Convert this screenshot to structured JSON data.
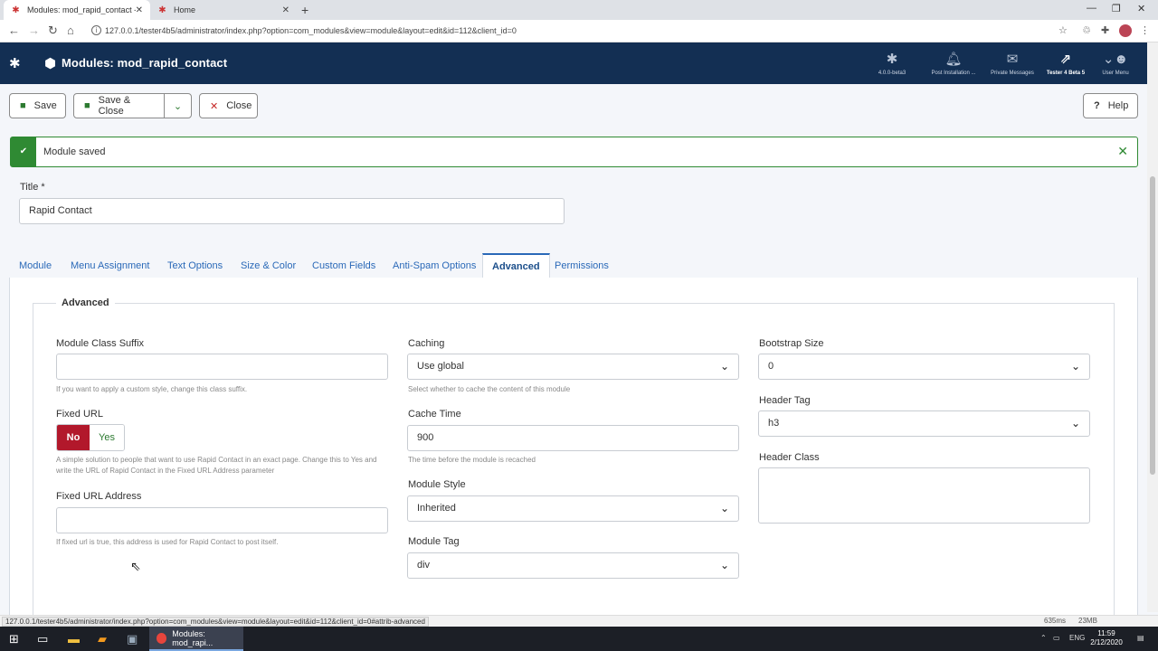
{
  "browser": {
    "tabs": [
      {
        "title": "Modules: mod_rapid_contact - Te",
        "close": "✕"
      },
      {
        "title": "Home",
        "close": "✕"
      }
    ],
    "new_tab": "+",
    "url": "127.0.0.1/tester4b5/administrator/index.php?option=com_modules&view=module&layout=edit&id=112&client_id=0",
    "window_controls": {
      "minimize": "—",
      "restore": "❐",
      "close": "✕"
    }
  },
  "header": {
    "title": "Modules: mod_rapid_contact",
    "items": [
      {
        "label": "4.0.0-beta3",
        "icon": "joomla-icon"
      },
      {
        "label": "Post Installation ...",
        "icon": "bell-icon"
      },
      {
        "label": "Private Messages",
        "icon": "envelope-icon"
      },
      {
        "label": "Tester 4 Beta 5",
        "icon": "external-link-icon"
      },
      {
        "label": "User Menu",
        "icon": "user-icon"
      }
    ]
  },
  "toolbar": {
    "save": "Save",
    "save_close": "Save & Close",
    "close": "Close",
    "help": "Help"
  },
  "alert": {
    "message": "Module saved"
  },
  "title_field": {
    "label": "Title *",
    "value": "Rapid Contact"
  },
  "tabs": [
    "Module",
    "Menu Assignment",
    "Text Options",
    "Size & Color",
    "Custom Fields",
    "Anti-Spam Options",
    "Advanced",
    "Permissions"
  ],
  "active_tab": "Advanced",
  "advanced": {
    "legend": "Advanced",
    "module_class_suffix": {
      "label": "Module Class Suffix",
      "value": "",
      "help": "If you want to apply a custom style, change this class suffix."
    },
    "fixed_url": {
      "label": "Fixed URL",
      "no": "No",
      "yes": "Yes",
      "selected": "No",
      "help": "A simple solution to people that want to use Rapid Contact in an exact page. Change this to Yes and write the URL of Rapid Contact in the Fixed URL Address parameter"
    },
    "fixed_url_address": {
      "label": "Fixed URL Address",
      "value": "",
      "help": "If fixed url is true, this address is used for Rapid Contact to post itself."
    },
    "caching": {
      "label": "Caching",
      "value": "Use global",
      "help": "Select whether to cache the content of this module"
    },
    "cache_time": {
      "label": "Cache Time",
      "value": "900",
      "help": "The time before the module is recached"
    },
    "module_style": {
      "label": "Module Style",
      "value": "Inherited"
    },
    "module_tag": {
      "label": "Module Tag",
      "value": "div"
    },
    "bootstrap_size": {
      "label": "Bootstrap Size",
      "value": "0"
    },
    "header_tag": {
      "label": "Header Tag",
      "value": "h3"
    },
    "header_class": {
      "label": "Header Class",
      "value": ""
    }
  },
  "statusbar": {
    "link": "127.0.0.1/tester4b5/administrator/index.php?option=com_modules&view=module&layout=edit&id=112&client_id=0#attrib-advanced",
    "time": "635ms",
    "memory": "23MB"
  },
  "taskbar": {
    "app": "Modules: mod_rapi...",
    "lang": "ENG",
    "time": "11:59",
    "date": "2/12/2020"
  }
}
